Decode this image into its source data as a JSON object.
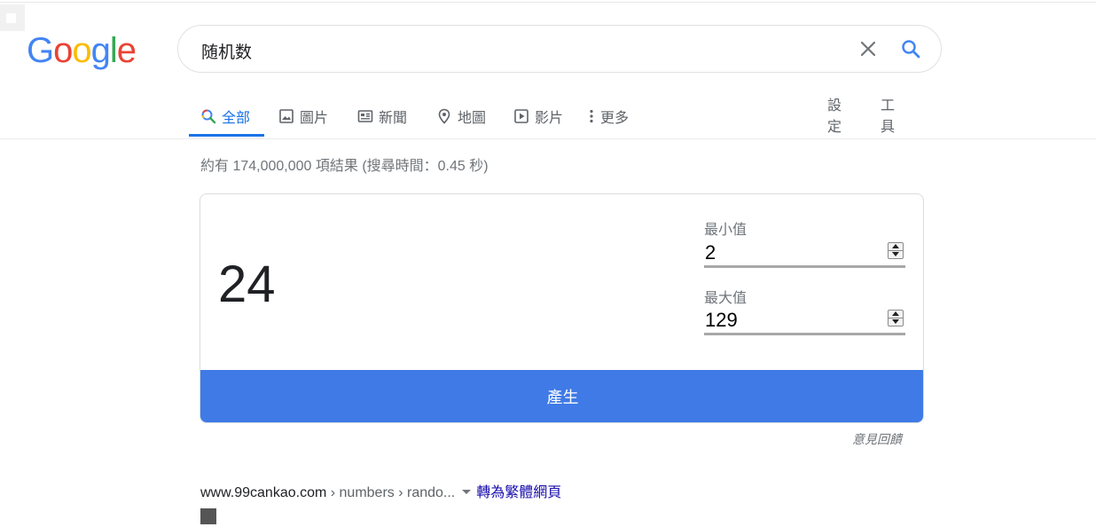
{
  "logo": {
    "letters": [
      "G",
      "o",
      "o",
      "g",
      "l",
      "e"
    ],
    "colors": [
      "#4285f4",
      "#ea4335",
      "#fbbc05",
      "#4285f4",
      "#34a853",
      "#ea4335"
    ]
  },
  "search": {
    "query": "随机数"
  },
  "tabs": [
    {
      "label": "全部",
      "icon": "search-icon",
      "active": true
    },
    {
      "label": "圖片",
      "icon": "image-icon"
    },
    {
      "label": "新聞",
      "icon": "news-icon"
    },
    {
      "label": "地圖",
      "icon": "map-pin-icon"
    },
    {
      "label": "影片",
      "icon": "video-icon"
    },
    {
      "label": "更多",
      "icon": "more-vert-icon"
    }
  ],
  "tools": {
    "settings": "設定",
    "tools": "工具"
  },
  "stats": "約有 174,000,000 項結果 (搜尋時間：0.45 秒)",
  "rng": {
    "result": "24",
    "min_label": "最小值",
    "min_value": "2",
    "max_label": "最大值",
    "max_value": "129",
    "generate_label": "產生"
  },
  "feedback": "意見回饋",
  "result1": {
    "domain": "www.99cankao.com",
    "path": " › numbers › rando...",
    "translate": "轉為繁體網頁"
  },
  "colors": {
    "accent": "#1a73e8",
    "button": "#3f7ae6",
    "link": "#1a0dab"
  }
}
